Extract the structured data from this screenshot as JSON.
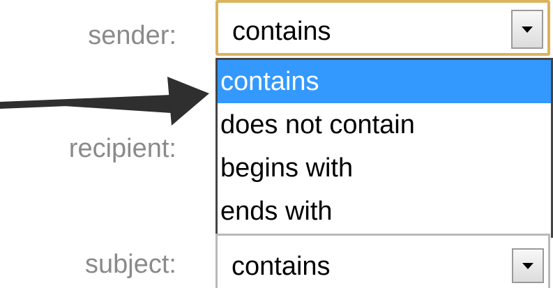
{
  "labels": {
    "sender": "sender:",
    "recipient": "recipient:",
    "subject": "subject:"
  },
  "sender_select": {
    "value": "contains",
    "icon": "chevron-down-icon",
    "focus_border_color": "#d9b45c"
  },
  "dropdown": {
    "options": [
      {
        "label": "contains",
        "selected": true
      },
      {
        "label": "does not contain",
        "selected": false
      },
      {
        "label": "begins with",
        "selected": false
      },
      {
        "label": "ends with",
        "selected": false
      }
    ],
    "highlight_color": "#3399ff"
  },
  "subject_select": {
    "value": "contains",
    "icon": "chevron-down-icon"
  },
  "annotation": {
    "icon": "arrow-right-icon",
    "color": "#2f2f2f"
  }
}
